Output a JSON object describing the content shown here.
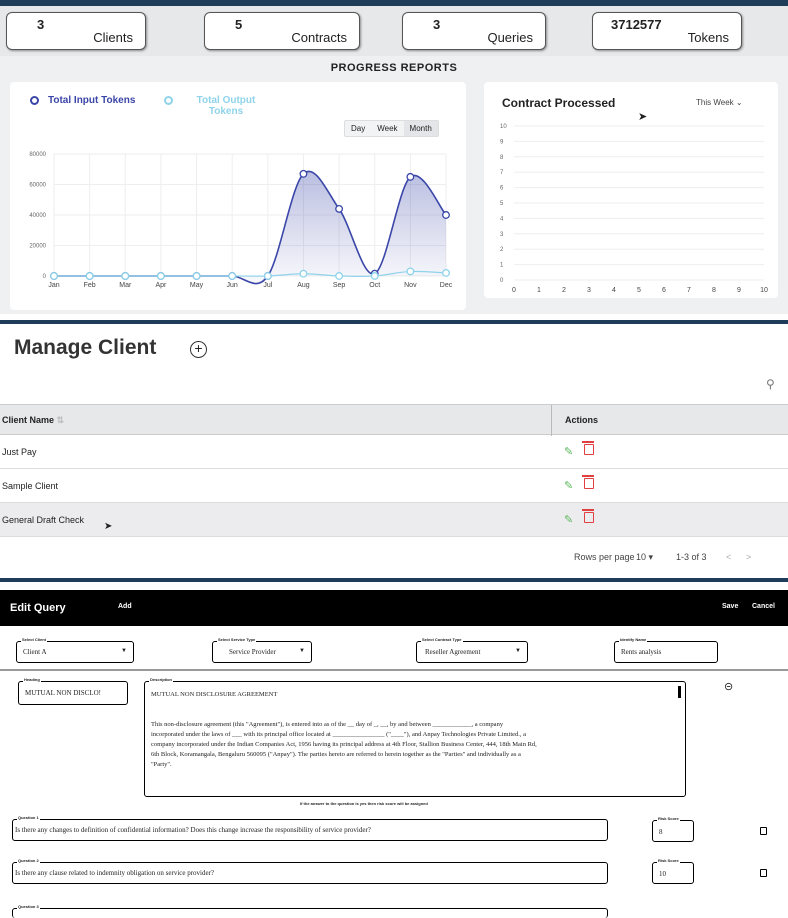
{
  "stats": [
    {
      "value": "3",
      "label": "Clients"
    },
    {
      "value": "5",
      "label": "Contracts"
    },
    {
      "value": "3",
      "label": "Queries"
    },
    {
      "value": "3712577",
      "label": "Tokens"
    }
  ],
  "progress": {
    "title": "PROGRESS REPORTS",
    "legend_input": "Total Input Tokens",
    "legend_output": "Total Output Tokens",
    "ranges": [
      "Day",
      "Week",
      "Month"
    ],
    "active_range": "Month",
    "contract_title": "Contract Processed",
    "contract_period": "This Week",
    "colors": {
      "input": "#3a46a8",
      "output": "#8fd3ea"
    }
  },
  "chart_data": [
    {
      "type": "area",
      "categories": [
        "Jan",
        "Feb",
        "Mar",
        "Apr",
        "May",
        "Jun",
        "Jul",
        "Aug",
        "Sep",
        "Oct",
        "Nov",
        "Dec"
      ],
      "series": [
        {
          "name": "Total Input Tokens",
          "values": [
            0,
            0,
            0,
            0,
            0,
            0,
            0,
            67000,
            44000,
            1500,
            65000,
            40000
          ]
        },
        {
          "name": "Total Output Tokens",
          "values": [
            0,
            0,
            0,
            0,
            0,
            0,
            0,
            1500,
            0,
            0,
            3000,
            2000
          ]
        }
      ],
      "yticks": [
        "0",
        "20000",
        "40000",
        "60000",
        "80000"
      ],
      "ylim": [
        0,
        80000
      ]
    },
    {
      "type": "line",
      "title": "Contract Processed",
      "xticks": [
        "0",
        "1",
        "2",
        "3",
        "4",
        "5",
        "6",
        "7",
        "8",
        "9",
        "10"
      ],
      "yticks": [
        "0",
        "1",
        "2",
        "3",
        "4",
        "5",
        "6",
        "7",
        "8",
        "9",
        "10"
      ],
      "xlim": [
        0,
        10
      ],
      "ylim": [
        0,
        10
      ],
      "series": []
    }
  ],
  "manage": {
    "title": "Manage Client",
    "col_name": "Client Name",
    "col_actions": "Actions",
    "rows": [
      "Just Pay",
      "Sample Client",
      "General Draft Check"
    ],
    "rows_per_page_label": "Rows per page",
    "rows_per_page": "10",
    "range": "1-3 of 3"
  },
  "edit_query": {
    "title": "Edit Query",
    "add": "Add",
    "save": "Save",
    "cancel": "Cancel",
    "select_client_label": "Select Client",
    "select_client": "Client A",
    "service_type_label": "Select Service Type",
    "service_type": "Service Provider",
    "contract_type_label": "Select Contract Type",
    "contract_type": "Reseller Agreement",
    "identify_name_label": "Identify Name",
    "identify_name": "Rents analysis",
    "heading_label": "Heading",
    "heading": "MUTUAL NON DISCLO!",
    "description_label": "Description",
    "description_title": "MUTUAL NON DISCLOSURE AGREEMENT",
    "description_lines": [
      "This non-disclosure agreement (this \"Agreement\"), is entered into as of the __ day of _, __, by and between ____________, a company",
      "incorporated under the laws of ___ with its principal office located at ________________ (\"____\"), and Anpay Technologies Private Limited., a",
      "company incorporated under the Indian Companies Act, 1956 having its principal address at 4th Floor, Stallion Business Center, 444, 18th Main Rd,",
      "6th Block, Koramangala, Bengaluru 560095 (\"Anpay\"). The parties hereto are referred to herein together as the \"Parties\" and individually as a",
      "\"Party\"."
    ],
    "hint": "If the answer to the question is yes then risk score will be assigned",
    "questions": [
      {
        "label": "Question 1",
        "text": "Is there any changes to definition of confidential information? Does this change increase the responsibility of service provider?",
        "risk_label": "Risk Score",
        "risk": "8"
      },
      {
        "label": "Question 2",
        "text": "Is there any clause related to indemnity obligation on service provider?",
        "risk_label": "Risk Score",
        "risk": "10"
      },
      {
        "label": "Question 3",
        "text": "",
        "risk_label": "",
        "risk": ""
      }
    ]
  }
}
